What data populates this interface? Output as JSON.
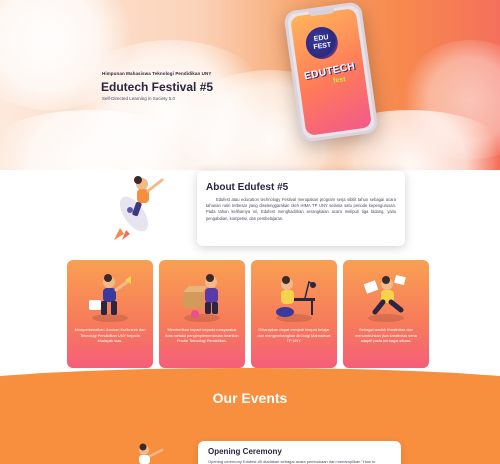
{
  "hero": {
    "subtitle": "Himpunan Mahasiswa Teknologi Pendidikan UNY",
    "title": "Edutech Festival #5",
    "tagline": "Self-Directed Learning in Society 5.0",
    "logo_badge": "EDU FEST",
    "logo_text": "EDUTECH",
    "logo_sub": "fest",
    "colors": {
      "primary": "#f7894d",
      "accent": "#f4705c",
      "dark": "#2a2540"
    }
  },
  "about": {
    "title": "About Edufest #5",
    "body": "Edufest atau education technology Festival merupakan program serja sibilit tahun sebagai acara tahunan rutin terbesar yang diselenggarakan oleh HIMA TP UNY selama satu periode kepengurusan. Pada tahun keliharnya ini, Edufest menghadirkan serangkaian acara meliputi tiga bidang, yaitu pengabdian, kompetisi, dan pembelajaran."
  },
  "features": [
    {
      "text": "Memperkenalkan Jurusan Kurikulum dan Teknologi Pendidikan UNY kepada khalayak luas.",
      "icon": "presenter-illustration"
    },
    {
      "text": "Memberikan impact kepada masyarakat luas melalui pengimplementasian keahlian Prodie Teknologi Pendidikan.",
      "icon": "package-illustration"
    },
    {
      "text": "Diharapkan dapat menjadi tempat belajar dan mengembangkan diri bagi Mahasiswa TP UNY.",
      "icon": "desk-study-illustration"
    },
    {
      "text": "Sebagai wadah Kreativitas dan menumbuhkan jiwa kreativitas serta adaptif pada berbagai situasi.",
      "icon": "jumping-illustration"
    }
  ],
  "events": {
    "title": "Our Events",
    "items": [
      {
        "title": "Opening Ceremony",
        "desc": "Opening ceremony Edufest #5 diadakan sebagai acara pembukaan dan menampilkan \"How to"
      }
    ]
  }
}
